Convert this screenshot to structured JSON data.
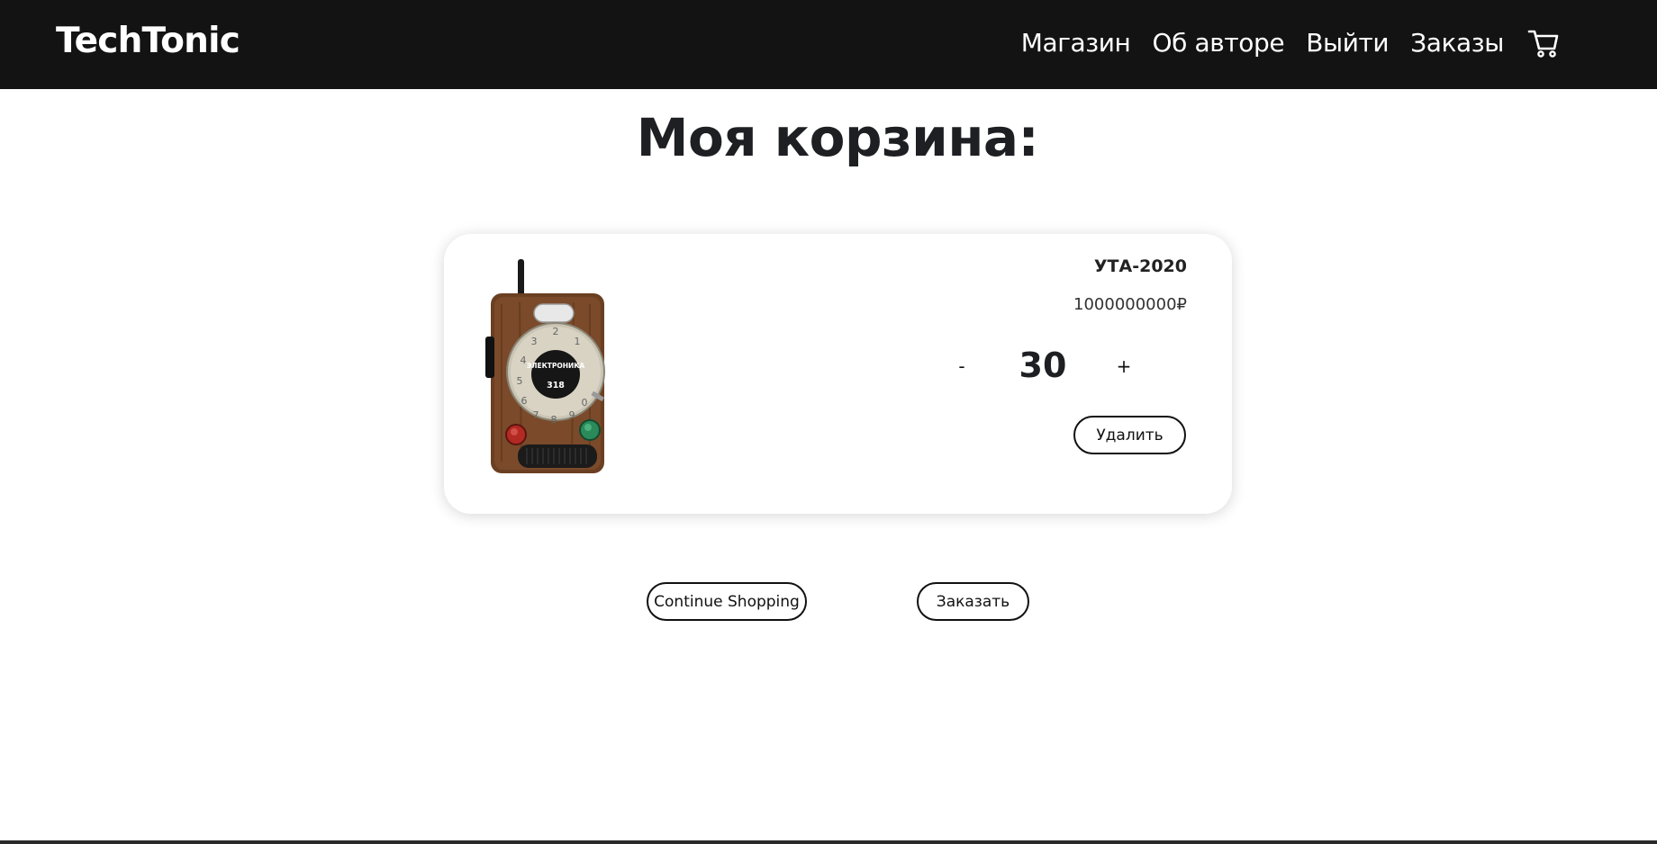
{
  "navbar": {
    "brand": "TechTonic",
    "links": [
      {
        "label": "Магазин"
      },
      {
        "label": "Об авторе"
      },
      {
        "label": "Выйти"
      },
      {
        "label": "Заказы"
      }
    ],
    "cart_icon": "cart-icon"
  },
  "page": {
    "title": "Моя корзина:"
  },
  "cart": {
    "items": [
      {
        "name": "УТА-2020",
        "price": "1000000000₽",
        "quantity": "30",
        "minus_label": "-",
        "plus_label": "+",
        "delete_label": "Удалить",
        "image_text_top": "ЭЛЕКТРОНИКА",
        "image_text_bottom": "318"
      }
    ]
  },
  "actions": {
    "continue_label": "Continue Shopping",
    "order_label": "Заказать"
  },
  "colors": {
    "navbar_bg": "#131313",
    "text": "#1e1f22",
    "button_border": "#111111"
  }
}
